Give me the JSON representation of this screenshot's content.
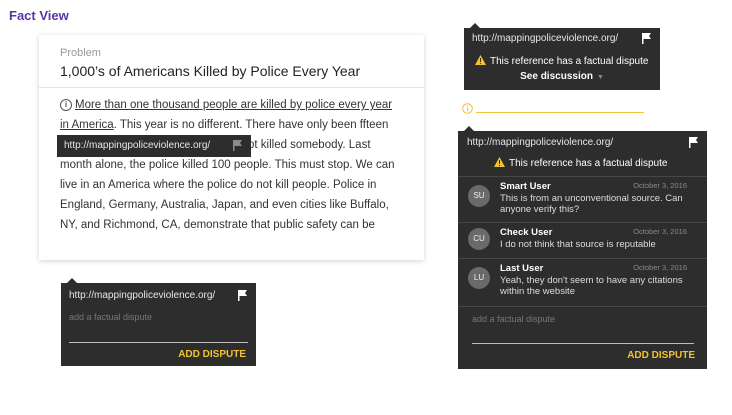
{
  "page_title": "Fact View",
  "problem_card": {
    "label": "Problem",
    "title": "1,000’s of Americans Killed by Police Every Year",
    "info_icon": "info-circle-icon",
    "line1_underlined": "More than one thousand people are killed by police every year",
    "line2_underlined": "in America",
    "line2_rest": ". This year is no different. There have only been ffteen",
    "line3": "ot killed somebody. Last",
    "line4": "month alone, the police killed 100 people. This must stop. We can",
    "line5": "live in an America where the police do not kill people. Police in",
    "line6": "England, Germany, Australia, Japan, and even cities like Buffalo,",
    "line7": "NY, and Richmond, CA, demonstrate that public safety can be"
  },
  "inline_tooltip": {
    "url": "http://mappingpoliceviolence.org/",
    "flag_icon": "flag-icon",
    "flag_color": "#8a8a8a"
  },
  "add_dispute_box": {
    "url": "http://mappingpoliceviolence.org/",
    "flag_icon": "flag-icon",
    "placeholder": "add a factual dispute",
    "button": "ADD DISPUTE"
  },
  "dispute_small": {
    "url": "http://mappingpoliceviolence.org/",
    "flag_icon": "flag-icon",
    "warning_icon": "warning-triangle-icon",
    "warning": "This reference has a factual dispute",
    "see_discussion": "See discussion",
    "caret_icon": "caret-down-icon"
  },
  "cursor_marker": {
    "icon": "info-circle-icon",
    "color": "#f1c232"
  },
  "dispute_large": {
    "url": "http://mappingpoliceviolence.org/",
    "flag_icon": "flag-icon",
    "warning_icon": "warning-triangle-icon",
    "warning": "This reference has a factual dispute",
    "comments": [
      {
        "initials": "SU",
        "user": "Smart User",
        "date": "October 3, 2016",
        "text": "This is from an unconventional source. Can anyone verify this?"
      },
      {
        "initials": "CU",
        "user": "Check User",
        "date": "October 3, 2016",
        "text": "I do not think that source is reputable"
      },
      {
        "initials": "LU",
        "user": "Last User",
        "date": "October 3, 2016",
        "text": "Yeah, they don't seem to have any citations within the website"
      }
    ],
    "placeholder": "add a factual dispute",
    "button": "ADD DISPUTE"
  },
  "colors": {
    "accent": "#f1c232",
    "title": "#5b35a8",
    "panel": "#2d2d2d"
  }
}
